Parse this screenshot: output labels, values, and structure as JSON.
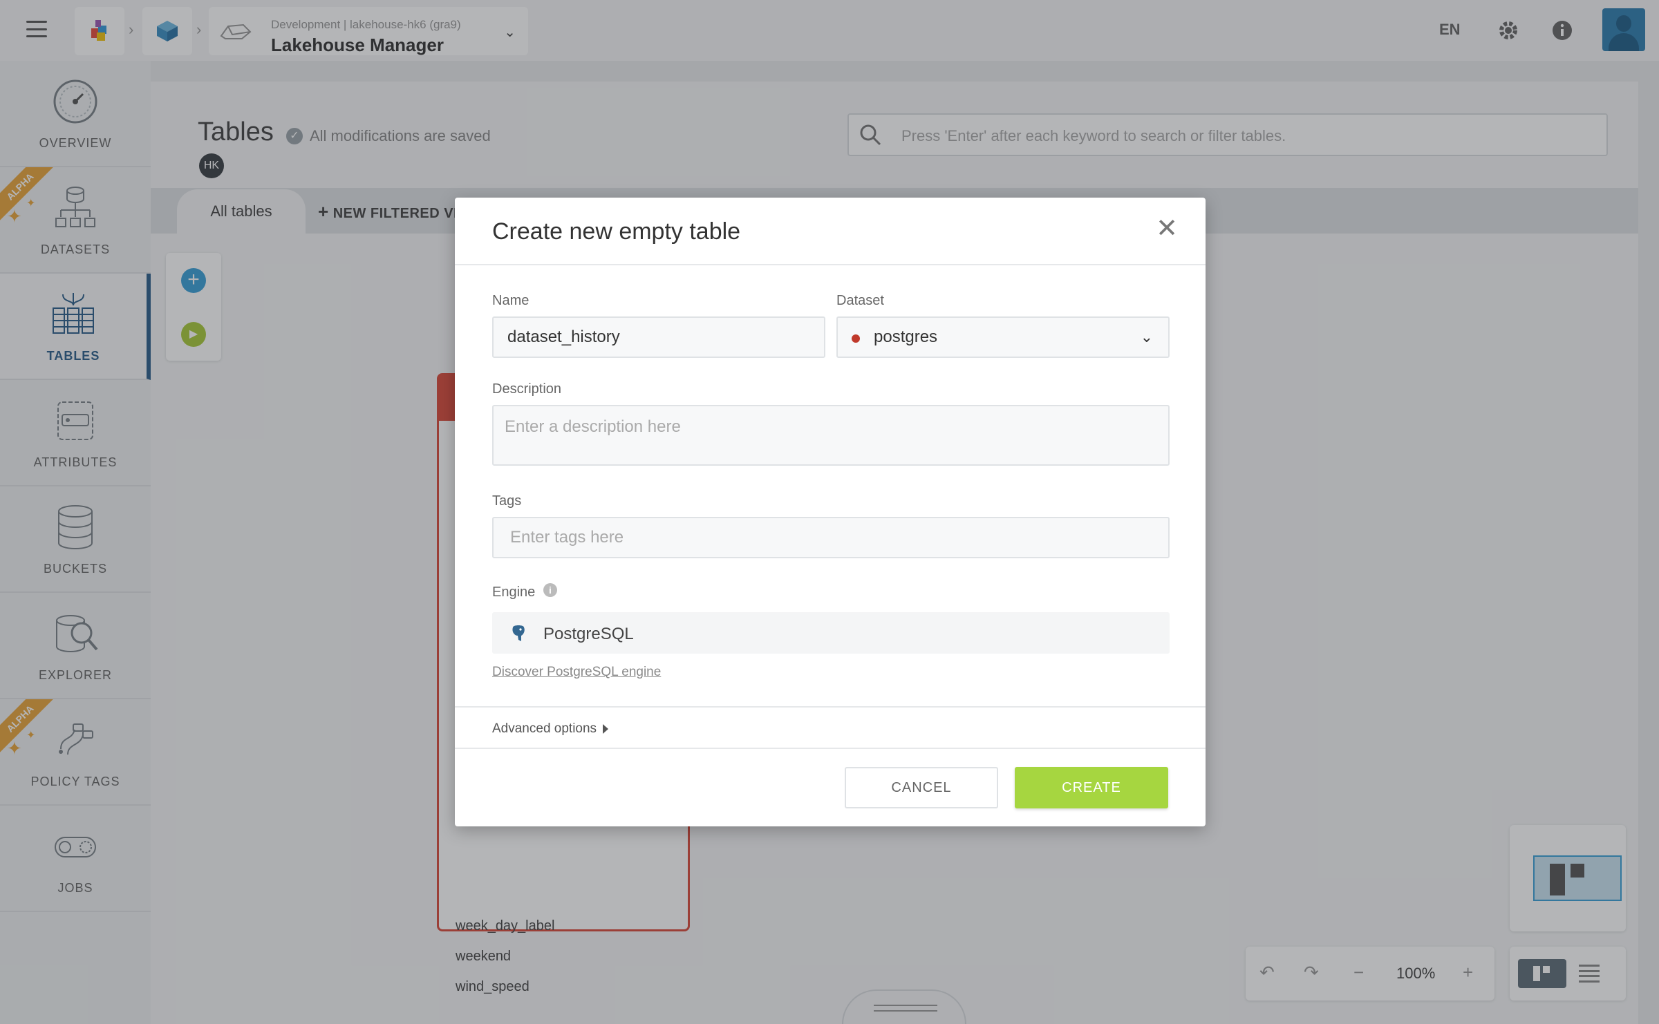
{
  "app": {
    "project_path": "Development | lakehouse-hk6 (gra9)",
    "title": "Lakehouse Manager",
    "language": "EN"
  },
  "sidebar": {
    "items": [
      {
        "label": "OVERVIEW",
        "icon": "gauge-icon",
        "alpha": false
      },
      {
        "label": "DATASETS",
        "icon": "dataset-tree-icon",
        "alpha": true
      },
      {
        "label": "TABLES",
        "icon": "tables-icon",
        "alpha": false,
        "active": true
      },
      {
        "label": "ATTRIBUTES",
        "icon": "attributes-icon",
        "alpha": false
      },
      {
        "label": "BUCKETS",
        "icon": "database-icon",
        "alpha": false
      },
      {
        "label": "EXPLORER",
        "icon": "database-search-icon",
        "alpha": false
      },
      {
        "label": "POLICY TAGS",
        "icon": "policy-tags-icon",
        "alpha": true
      },
      {
        "label": "JOBS",
        "icon": "jobs-icon",
        "alpha": false
      }
    ],
    "alpha_label": "ALPHA"
  },
  "page": {
    "title": "Tables",
    "save_status": "All modifications are saved",
    "user_initials": "HK",
    "search_placeholder": "Press 'Enter' after each keyword to search or filter tables.",
    "tabs": {
      "all": "All tables",
      "new_filtered_view": "NEW FILTERED VI"
    }
  },
  "table_card": {
    "fields": [
      "week_day_label",
      "weekend",
      "wind_speed"
    ]
  },
  "canvas": {
    "zoom": "100%"
  },
  "modal": {
    "title": "Create new empty table",
    "name": {
      "label": "Name",
      "value": "dataset_history"
    },
    "dataset": {
      "label": "Dataset",
      "value": "postgres"
    },
    "description": {
      "label": "Description",
      "placeholder": "Enter a description here"
    },
    "tags": {
      "label": "Tags",
      "placeholder": "Enter tags here"
    },
    "engine": {
      "label": "Engine",
      "value": "PostgreSQL",
      "link": "Discover PostgreSQL engine"
    },
    "advanced": "Advanced options",
    "cancel": "CANCEL",
    "create": "CREATE"
  },
  "colors": {
    "accent": "#2b5f8a",
    "create_button": "#a6d640",
    "alpha_badge": "#e8a53b",
    "table_border": "#d94a3b",
    "dataset_dot": "#c0392b"
  }
}
